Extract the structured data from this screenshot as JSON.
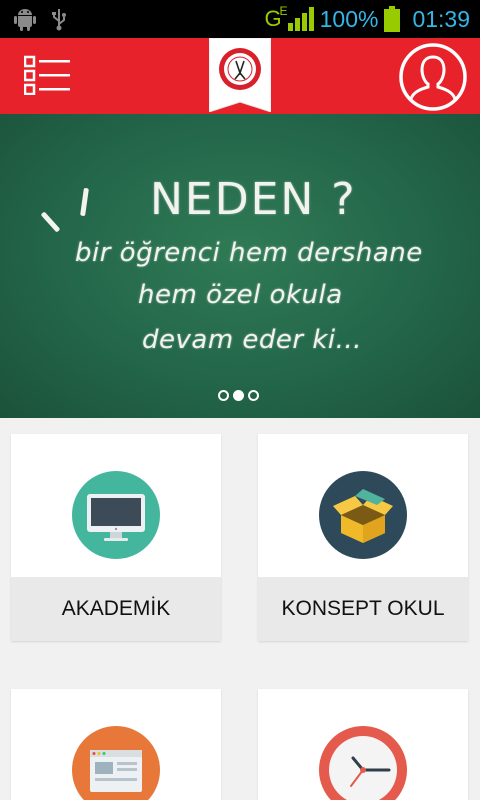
{
  "status_bar": {
    "network": "G",
    "network_sup": "E",
    "battery": "100%",
    "time": "01:39",
    "icons": [
      "android-debug-icon",
      "usb-icon",
      "signal-icon",
      "battery-icon"
    ]
  },
  "app_bar": {
    "menu_icon": "list-menu-icon",
    "logo": "school-logo",
    "profile_icon": "user-profile-icon",
    "color": "#e8222b"
  },
  "banner": {
    "title": "NEDEN ?",
    "line1": "bir öğrenci hem dershane",
    "line2": "hem özel okula",
    "line3": "devam eder ki...",
    "slides": 3,
    "active_slide": 2
  },
  "cards": [
    {
      "label": "AKADEMİK",
      "icon": "monitor-icon",
      "color": "#44b69d"
    },
    {
      "label": "KONSEPT OKUL",
      "icon": "open-box-icon",
      "color": "#2e4a5a"
    },
    {
      "label": "",
      "icon": "browser-window-icon",
      "color": "#e8773a"
    },
    {
      "label": "",
      "icon": "clock-icon",
      "color": "#e45a4c"
    }
  ]
}
